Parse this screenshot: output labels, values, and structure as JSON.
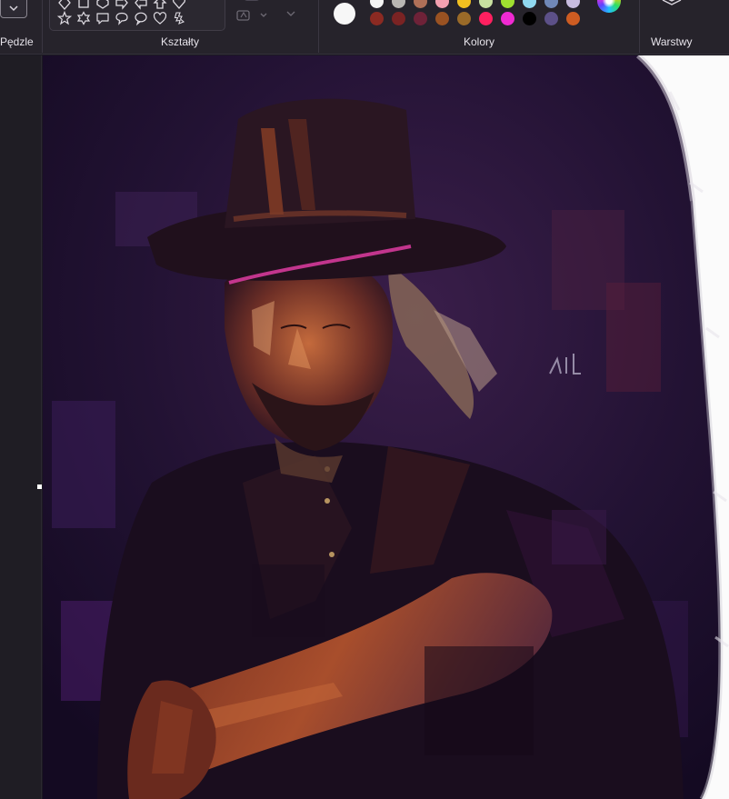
{
  "ribbon": {
    "groups": {
      "brushes": "Pędzle",
      "shapes": "Kształty",
      "colors": "Kolory",
      "layers": "Warstwy"
    },
    "shapes_row1_icons": [
      "diamond-shape-icon",
      "rectangle-shape-icon",
      "pentagon-shape-icon",
      "arrow-right-shape-icon",
      "arrow-left-shape-icon",
      "arrow-up-shape-icon",
      "heart-shape-icon"
    ],
    "shapes_row2_icons": [
      "star-shape-icon",
      "six-point-star-shape-icon",
      "speech-bubble-rect-icon",
      "speech-bubble-round-icon",
      "speech-bubble-oval-icon",
      "heart-outline-shape-icon",
      "lightning-shape-icon"
    ],
    "active_color": "#f7f7f7",
    "palette_row1": [
      "#f4f4f4",
      "#b9b6b3",
      "#b07058",
      "#f4a0b0",
      "#f2c020",
      "#c8e0a0",
      "#a0e030",
      "#90d8f0",
      "#7088b8",
      "#c8bce0"
    ],
    "palette_row2": [
      "#8b2a22",
      "#7a2323",
      "#6e2238",
      "#9a5222",
      "#9a6a28",
      "#ff2060",
      "#f02ad2",
      "#000000",
      "#5c5088",
      "#cd5c22"
    ]
  },
  "colors": {
    "ribbon_bg": "#26232b",
    "panel_bg": "#1f1d24",
    "canvas_bg": "#fbfbfb",
    "painting_base": "#1b0f2c"
  }
}
